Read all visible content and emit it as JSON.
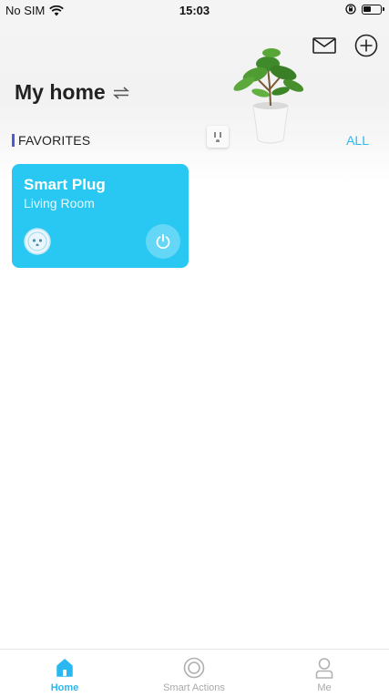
{
  "status_bar": {
    "carrier": "No SIM",
    "time": "15:03"
  },
  "header": {
    "title": "My home"
  },
  "favorites": {
    "label": "FAVORITES",
    "all_link": "ALL"
  },
  "devices": [
    {
      "name": "Smart Plug",
      "room": "Living Room",
      "power_state": "off"
    }
  ],
  "tabs": [
    {
      "label": "Home",
      "icon": "home-icon",
      "active": true
    },
    {
      "label": "Smart Actions",
      "icon": "smart-actions-icon",
      "active": false
    },
    {
      "label": "Me",
      "icon": "person-icon",
      "active": false
    }
  ],
  "colors": {
    "accent": "#2ab8f0",
    "card": "#28c8f2",
    "favorites_marker": "#4a5bd9"
  }
}
